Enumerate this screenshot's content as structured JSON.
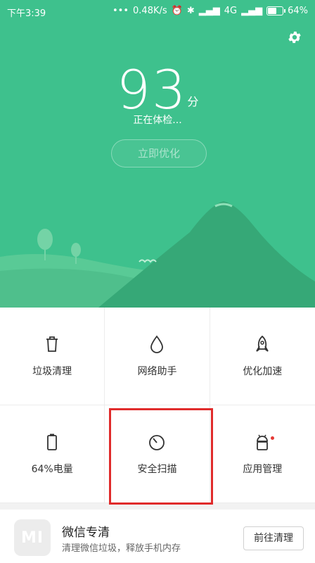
{
  "status_bar": {
    "time": "下午3:39",
    "speed": "0.48K/s",
    "network": "4G",
    "battery": "64%"
  },
  "hero": {
    "score": "93",
    "score_unit": "分",
    "status_text": "正在体检...",
    "optimize_label": "立即优化",
    "background_color": "#3ec18d"
  },
  "tools": [
    {
      "label": "垃圾清理",
      "icon": "trash-icon"
    },
    {
      "label": "网络助手",
      "icon": "droplet-icon"
    },
    {
      "label": "优化加速",
      "icon": "rocket-icon"
    },
    {
      "label": "64%电量",
      "icon": "battery-icon"
    },
    {
      "label": "安全扫描",
      "icon": "scan-timer-icon"
    },
    {
      "label": "应用管理",
      "icon": "android-icon",
      "badge": true
    }
  ],
  "promo": {
    "title": "微信专清",
    "subtitle": "清理微信垃圾，释放手机内存",
    "button_label": "前往清理",
    "icon_text": "MI"
  },
  "colors": {
    "accent": "#3ec18d",
    "highlight": "#e02b2b",
    "badge": "#e53935"
  }
}
